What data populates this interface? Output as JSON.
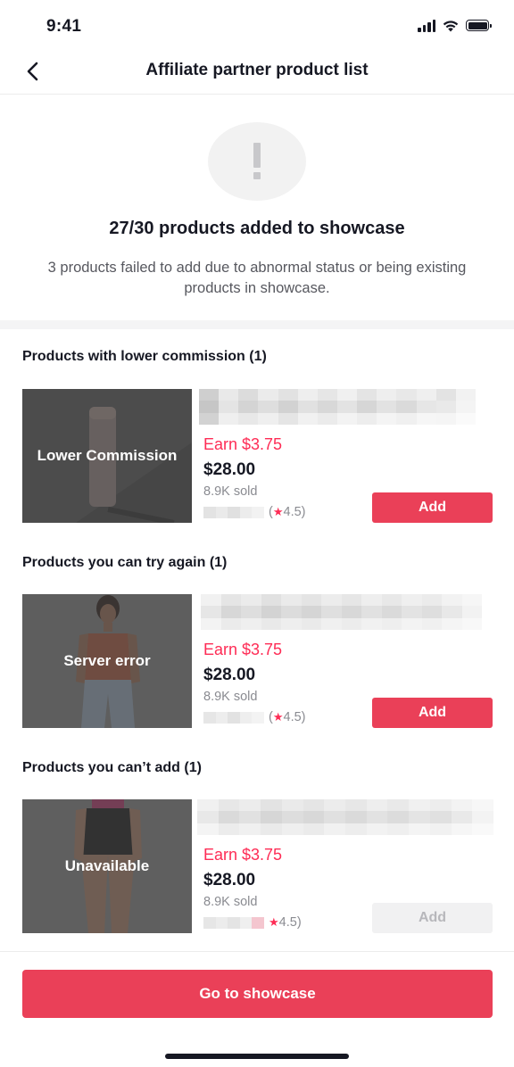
{
  "status_bar": {
    "time": "9:41"
  },
  "nav": {
    "title": "Affiliate partner product list"
  },
  "hero": {
    "icon": "exclamation-icon",
    "title": "27/30 products added to showcase",
    "description": "3 products failed to add due to abnormal status or being existing products in showcase."
  },
  "sections": [
    {
      "title": "Products with lower commission (1)",
      "product": {
        "status_label": "Lower Commission",
        "earn": "Earn $3.75",
        "price": "$28.00",
        "sold": "8.9K sold",
        "rating": "4.5",
        "add_label": "Add",
        "add_enabled": true
      }
    },
    {
      "title": "Products you can try again (1)",
      "product": {
        "status_label": "Server error",
        "earn": "Earn $3.75",
        "price": "$28.00",
        "sold": "8.9K sold",
        "rating": "4.5",
        "add_label": "Add",
        "add_enabled": true
      }
    },
    {
      "title": "Products you can’t add (1)",
      "product": {
        "status_label": "Unavailable",
        "earn": "Earn $3.75",
        "price": "$28.00",
        "sold": "8.9K sold",
        "rating": "4.5",
        "add_label": "Add",
        "add_enabled": false
      }
    }
  ],
  "footer": {
    "button_label": "Go to showcase"
  },
  "colors": {
    "accent": "#ea4058",
    "earn": "#fe2c55",
    "muted": "#8a8b91"
  }
}
